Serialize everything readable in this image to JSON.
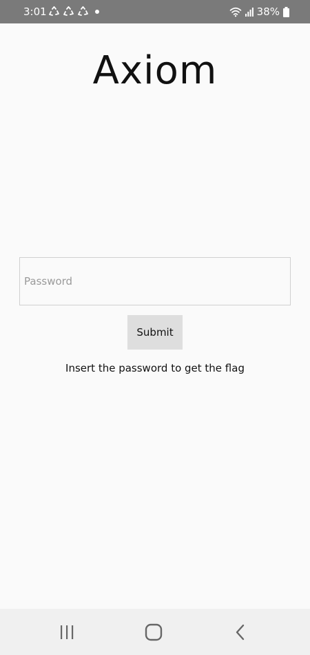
{
  "status_bar": {
    "time": "3:01",
    "notification_icons": [
      "recycle-icon",
      "recycle-icon",
      "recycle-icon",
      "dot-icon"
    ],
    "wifi_icon": "wifi-icon",
    "signal_icon": "signal-icon",
    "battery_percent": "38%",
    "battery_icon": "battery-icon",
    "background_color": "#7a7a7a"
  },
  "app": {
    "title": "Axiom"
  },
  "form": {
    "password_placeholder": "Password",
    "password_value": "",
    "submit_label": "Submit",
    "message": "Insert the password to get the flag"
  },
  "nav_bar": {
    "recents_icon": "recents-icon",
    "home_icon": "home-icon",
    "back_icon": "back-icon"
  }
}
